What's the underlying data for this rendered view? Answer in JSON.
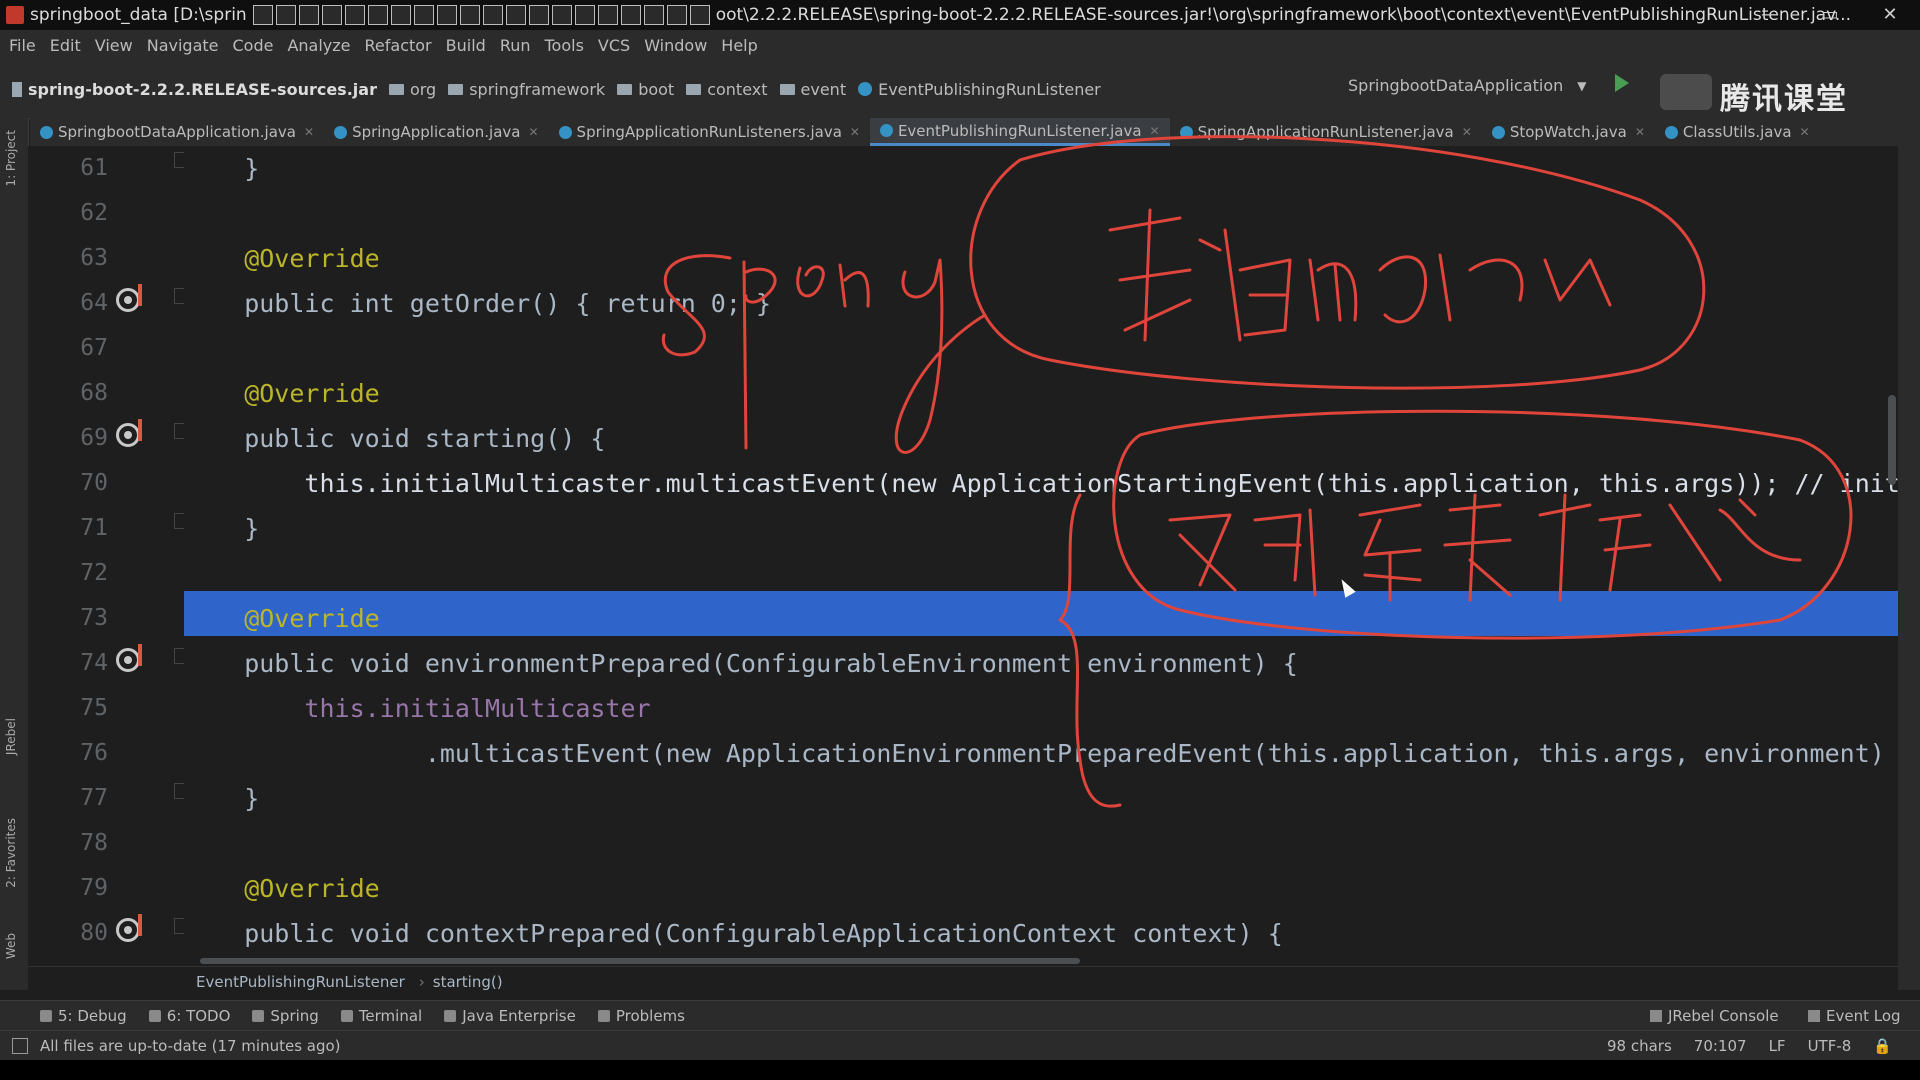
{
  "window": {
    "title_left": "springboot_data [D:\\sprin",
    "title_right": "oot\\2.2.2.RELEASE\\spring-boot-2.2.2.RELEASE-sources.jar!\\org\\springframework\\boot\\context\\event\\EventPublishingRunListener.jav...",
    "minimize": "—",
    "maximize": "▭",
    "close": "✕"
  },
  "menu": [
    "File",
    "Edit",
    "View",
    "Navigate",
    "Code",
    "Analyze",
    "Refactor",
    "Build",
    "Run",
    "Tools",
    "VCS",
    "Window",
    "Help"
  ],
  "breadcrumbs": {
    "jar": "spring-boot-2.2.2.RELEASE-sources.jar",
    "items": [
      "org",
      "springframework",
      "boot",
      "context",
      "event"
    ],
    "class": "EventPublishingRunListener"
  },
  "run_config": "SpringbootDataApplication",
  "logo_text": "腾讯课堂",
  "tabs": [
    {
      "label": "SpringbootDataApplication.java",
      "active": false
    },
    {
      "label": "SpringApplication.java",
      "active": false
    },
    {
      "label": "SpringApplicationRunListeners.java",
      "active": false
    },
    {
      "label": "EventPublishingRunListener.java",
      "active": true
    },
    {
      "label": "SpringApplicationRunListener.java",
      "active": false
    },
    {
      "label": "StopWatch.java",
      "active": false
    },
    {
      "label": "ClassUtils.java",
      "active": false
    }
  ],
  "side_tools": {
    "project": "1: Project",
    "jrebel": "JRebel",
    "favorites": "2: Favorites",
    "web": "Web"
  },
  "code_lines": [
    {
      "n": "61",
      "text": "    }"
    },
    {
      "n": "62",
      "text": ""
    },
    {
      "n": "63",
      "text": "    @Override"
    },
    {
      "n": "64",
      "text": "    public int getOrder() { return 0; }"
    },
    {
      "n": "67",
      "text": ""
    },
    {
      "n": "68",
      "text": "    @Override"
    },
    {
      "n": "69",
      "text": "    public void starting() {"
    },
    {
      "n": "70",
      "text": "        this.initialMulticaster.multicastEvent(new ApplicationStartingEvent(this.application, this.args)); // init"
    },
    {
      "n": "71",
      "text": "    }"
    },
    {
      "n": "72",
      "text": ""
    },
    {
      "n": "73",
      "text": "    @Override"
    },
    {
      "n": "74",
      "text": "    public void environmentPrepared(ConfigurableEnvironment environment) {"
    },
    {
      "n": "75",
      "text": "        this.initialMulticaster"
    },
    {
      "n": "76",
      "text": "                .multicastEvent(new ApplicationEnvironmentPreparedEvent(this.application, this.args, environment)"
    },
    {
      "n": "77",
      "text": "    }"
    },
    {
      "n": "78",
      "text": ""
    },
    {
      "n": "79",
      "text": "    @Override"
    },
    {
      "n": "80",
      "text": "    public void contextPrepared(ConfigurableApplicationContext context) {"
    }
  ],
  "editor_breadcrumb": {
    "class": "EventPublishingRunListener",
    "method": "starting()"
  },
  "tool_windows": [
    "5: Debug",
    "6: TODO",
    "Spring",
    "Terminal",
    "Java Enterprise",
    "Problems"
  ],
  "tool_windows_right": [
    "JRebel Console",
    "Event Log"
  ],
  "status": {
    "message": "All files are up-to-date (17 minutes ago)",
    "chars": "98 chars",
    "position": "70:107",
    "line_sep": "LF",
    "encoding": "UTF-8"
  },
  "colors": {
    "selection": "#2f65ca",
    "keyword": "#cc7832",
    "annotation": "#bbb529",
    "method": "#ffc66d",
    "field": "#9876aa",
    "ink": "#e0453c"
  }
}
